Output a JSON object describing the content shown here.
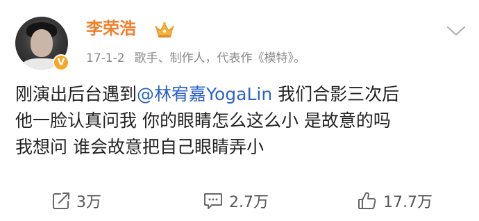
{
  "post": {
    "author": {
      "name": "李荣浩",
      "verified_icon": "verified-v-icon",
      "verified_glyph": "V",
      "badge_icon": "crown-icon"
    },
    "meta": {
      "time": "17-1-2",
      "description": "歌手、制作人，代表作《模特》。"
    },
    "menu_icon": "chevron-down-icon",
    "content": {
      "line1_prefix": "刚演出后台遇到",
      "mention": "@林宥嘉YogaLin",
      "line1_suffix": " 我们合影三次后",
      "line2": "他一脸认真问我 你的眼睛怎么这么小 是故意的吗",
      "line3": "我想问 谁会故意把自己眼睛弄小"
    },
    "actions": {
      "repost": {
        "icon": "repost-icon",
        "count": "3万"
      },
      "comment": {
        "icon": "comment-icon",
        "count": "2.7万"
      },
      "like": {
        "icon": "thumbs-up-icon",
        "count": "17.7万"
      }
    },
    "colors": {
      "username": "#f0802c",
      "mention": "#2d63c8",
      "meta": "#8a8a8a",
      "verified_badge": "#f5a623"
    }
  }
}
